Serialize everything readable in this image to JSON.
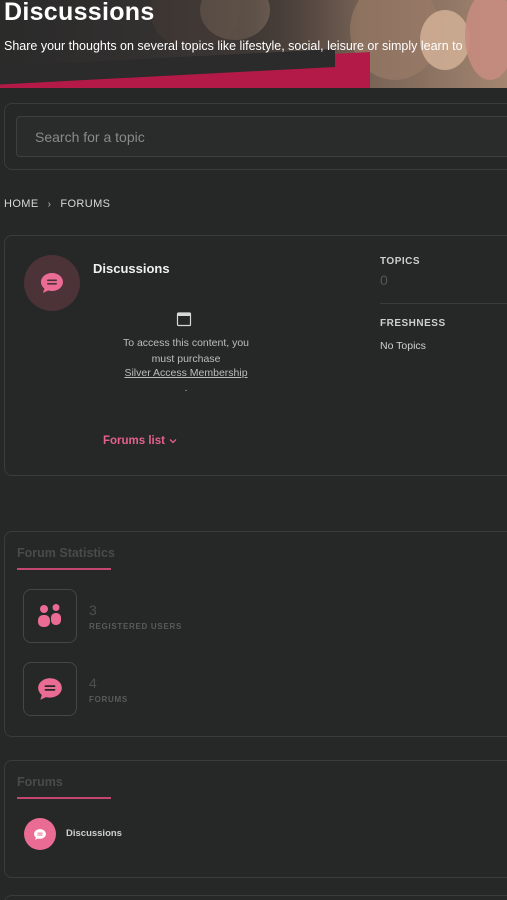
{
  "hero": {
    "title": "Discussions",
    "subtitle": "Share your thoughts on several topics like lifestyle, social, leisure or simply learn to"
  },
  "search": {
    "placeholder": "Search for a topic",
    "value": ""
  },
  "breadcrumb": {
    "home": "HOME",
    "separator": "›",
    "current": "FORUMS"
  },
  "forum_card": {
    "name": "Discussions",
    "locked_line1": "To access this content, you",
    "locked_line2": "must purchase",
    "membership_link": "Silver Access Membership",
    "locked_dot": ".",
    "forums_list_label": "Forums list",
    "topics_label": "TOPICS",
    "topics_value": "0",
    "freshness_label": "FRESHNESS",
    "freshness_value": "No Topics"
  },
  "stats": {
    "title": "Forum Statistics",
    "items": [
      {
        "value": "3",
        "label": "REGISTERED USERS",
        "icon": "users-icon"
      },
      {
        "value": "4",
        "label": "FORUMS",
        "icon": "chat-bubble-icon"
      }
    ]
  },
  "forums_section": {
    "title": "Forums",
    "items": [
      {
        "label": "Discussions",
        "icon": "chat-bubble-icon"
      }
    ]
  },
  "colors": {
    "accent": "#ea6b93",
    "accent_dark": "#b41a48",
    "background": "#262727"
  }
}
